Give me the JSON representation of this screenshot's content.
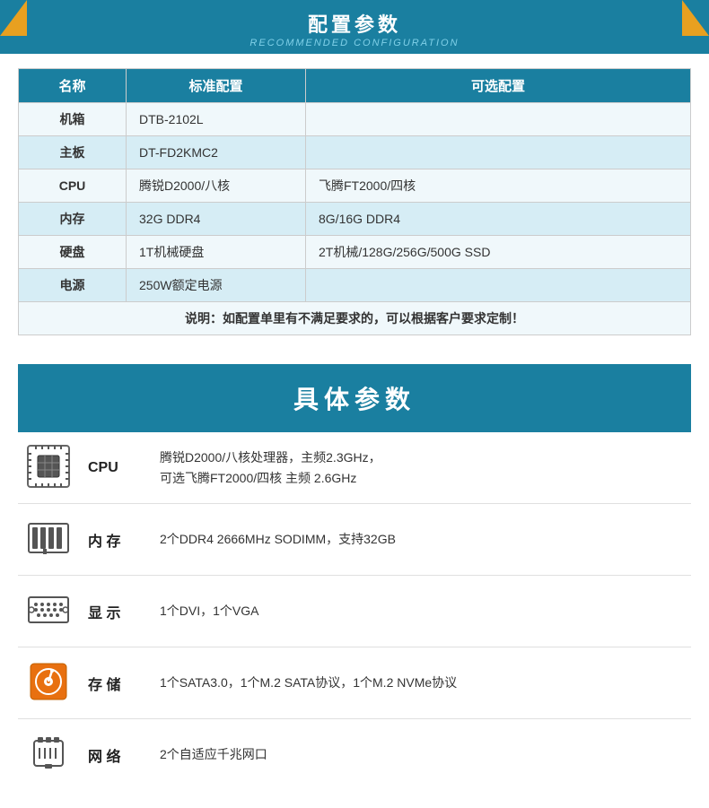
{
  "header": {
    "title_zh": "配置参数",
    "title_en": "RECOMMENDED CONFIGURATION"
  },
  "config_table": {
    "headers": [
      "名称",
      "标准配置",
      "可选配置"
    ],
    "rows": [
      {
        "name": "机箱",
        "standard": "DTB-2102L",
        "optional": ""
      },
      {
        "name": "主板",
        "standard": "DT-FD2KMC2",
        "optional": ""
      },
      {
        "name": "CPU",
        "standard": "腾锐D2000/八核",
        "optional": "飞腾FT2000/四核"
      },
      {
        "name": "内存",
        "standard": "32G DDR4",
        "optional": "8G/16G DDR4"
      },
      {
        "name": "硬盘",
        "standard": "1T机械硬盘",
        "optional": "2T机械/128G/256G/500G SSD"
      },
      {
        "name": "电源",
        "standard": "250W额定电源",
        "optional": ""
      }
    ],
    "notice": "说明：如配置单里有不满足要求的，可以根据客户要求定制！"
  },
  "params_section": {
    "title": "具体参数",
    "items": [
      {
        "icon": "cpu",
        "label": "CPU",
        "value": "腾锐D2000/八核处理器，主频2.3GHz，\n可选飞腾FT2000/四核 主频 2.6GHz"
      },
      {
        "icon": "memory",
        "label": "内 存",
        "value": "2个DDR4 2666MHz SODIMM，支持32GB"
      },
      {
        "icon": "display",
        "label": "显 示",
        "value": "1个DVI，1个VGA"
      },
      {
        "icon": "storage",
        "label": "存 储",
        "value": "1个SATA3.0，1个M.2 SATA协议，1个M.2 NVMe协议"
      },
      {
        "icon": "network",
        "label": "网 络",
        "value": "2个自适应千兆网口"
      }
    ]
  },
  "colors": {
    "primary": "#1a7fa0",
    "accent": "#e8a020",
    "light_bg": "#f0f8fb",
    "mid_bg": "#d6edf5"
  }
}
